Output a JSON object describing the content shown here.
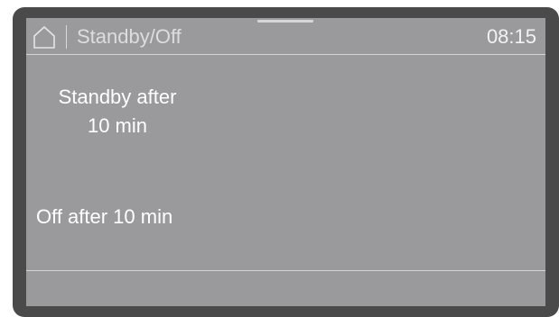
{
  "header": {
    "icon": "home-icon",
    "title": "Standby/Off",
    "time": "08:15"
  },
  "options": {
    "standby_line1": "Standby after",
    "standby_line2": "10 min",
    "off": "Off after 10 min"
  },
  "colors": {
    "bezel": "#4a4a4a",
    "screen": "#9a9a9c",
    "text": "#ffffff",
    "rule": "#d4d4d4"
  }
}
